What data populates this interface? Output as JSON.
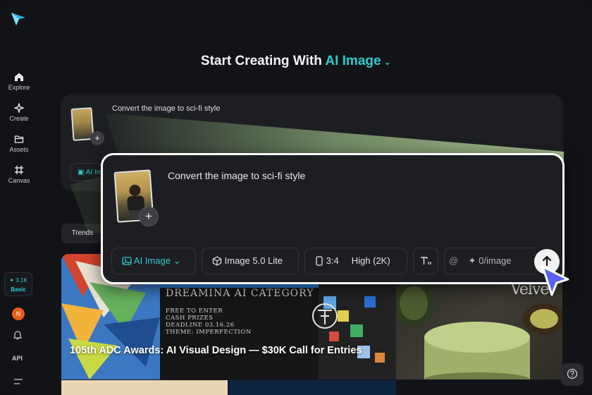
{
  "sidebar": {
    "items": [
      {
        "label": "Explore",
        "icon": "home-icon"
      },
      {
        "label": "Create",
        "icon": "sparkle-icon"
      },
      {
        "label": "Assets",
        "icon": "folder-icon"
      },
      {
        "label": "Canvas",
        "icon": "canvas-icon"
      }
    ],
    "credits": {
      "amount": "3.1K",
      "plan": "Basic"
    },
    "avatar_initial": "N",
    "api_label": "API"
  },
  "heading": {
    "prefix": "Start Creating With",
    "mode": "AI Image"
  },
  "background_prompt": {
    "text": "Convert the image to sci-fi style",
    "chip_label": "AI Im"
  },
  "trends_tab": "Trends",
  "prompt": {
    "text": "Convert the image to sci-fi style",
    "toolbar": {
      "mode": "AI Image",
      "model": "Image 5.0 Lite",
      "ratio": "3:4",
      "quality": "High (2K)",
      "at_symbol": "@",
      "reference": "0/image"
    }
  },
  "gallery": {
    "card1": {
      "caption": "105th ADC Awards: AI Visual Design — $30K Call for Entries",
      "poster_title": "DREAMINA AI CATEGORY",
      "poster_lines": [
        "FREE TO ENTER",
        "CASH PRIZES",
        "DEADLINE 03.16.26",
        "THEME: IMPERFECTION"
      ]
    },
    "card2": {
      "brand": "Velve"
    }
  },
  "colors": {
    "accent": "#30c9cf",
    "background": "#121316",
    "panel": "#1d1e22"
  }
}
